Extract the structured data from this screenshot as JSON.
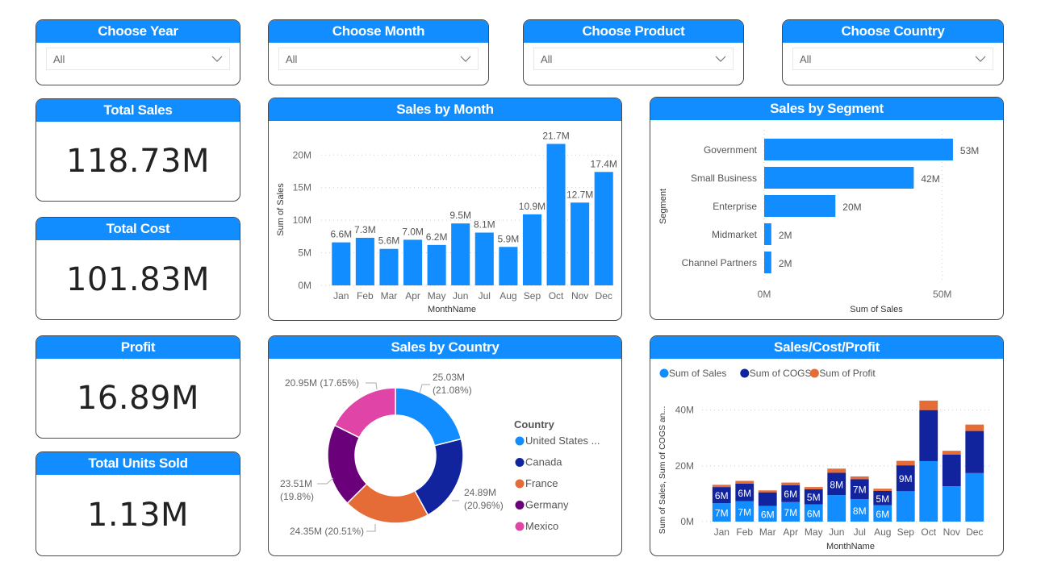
{
  "slicers": [
    {
      "title": "Choose Year",
      "value": "All"
    },
    {
      "title": "Choose Month",
      "value": "All"
    },
    {
      "title": "Choose Product",
      "value": "All"
    },
    {
      "title": "Choose Country",
      "value": "All"
    }
  ],
  "kpis": [
    {
      "title": "Total Sales",
      "value": "118.73M"
    },
    {
      "title": "Total Cost",
      "value": "101.83M"
    },
    {
      "title": "Profit",
      "value": "16.89M"
    },
    {
      "title": "Total Units Sold",
      "value": "1.13M"
    }
  ],
  "colors": {
    "accent": "#118DFF",
    "sales": "#118DFF",
    "cogs": "#12239E",
    "profit": "#E66C37",
    "germany": "#6B007B",
    "mexico": "#E044A7"
  },
  "chart_data": [
    {
      "id": "sales_by_month",
      "type": "bar",
      "title": "Sales by Month",
      "xlabel": "MonthName",
      "ylabel": "Sum of Sales",
      "categories": [
        "Jan",
        "Feb",
        "Mar",
        "Apr",
        "May",
        "Jun",
        "Jul",
        "Aug",
        "Sep",
        "Oct",
        "Nov",
        "Dec"
      ],
      "values": [
        6.6,
        7.3,
        5.6,
        7.0,
        6.2,
        9.5,
        8.1,
        5.9,
        10.9,
        21.7,
        12.7,
        17.4
      ],
      "data_labels": [
        "6.6M",
        "7.3M",
        "5.6M",
        "7.0M",
        "6.2M",
        "9.5M",
        "8.1M",
        "5.9M",
        "10.9M",
        "21.7M",
        "12.7M",
        "17.4M"
      ],
      "yticks": [
        0,
        5,
        10,
        15,
        20
      ],
      "ytick_labels": [
        "0M",
        "5M",
        "10M",
        "15M",
        "20M"
      ],
      "ylim": [
        0,
        23
      ],
      "unit": "M",
      "grid": true
    },
    {
      "id": "sales_by_segment",
      "type": "bar",
      "orientation": "horizontal",
      "title": "Sales by Segment",
      "xlabel": "Sum of Sales",
      "ylabel": "Segment",
      "categories": [
        "Government",
        "Small Business",
        "Enterprise",
        "Midmarket",
        "Channel Partners"
      ],
      "values": [
        53,
        42,
        20,
        2,
        2
      ],
      "data_labels": [
        "53M",
        "42M",
        "20M",
        "2M",
        "2M"
      ],
      "xticks": [
        0,
        50
      ],
      "xtick_labels": [
        "0M",
        "50M"
      ],
      "xlim": [
        0,
        58
      ],
      "grid": true
    },
    {
      "id": "sales_by_country",
      "type": "pie",
      "donut": true,
      "title": "Sales by Country",
      "legend_title": "Country",
      "legend_position": "right",
      "categories": [
        "United States ...",
        "Canada",
        "France",
        "Germany",
        "Mexico"
      ],
      "values": [
        25.03,
        24.89,
        24.35,
        23.51,
        20.95
      ],
      "percentages": [
        21.08,
        20.96,
        20.51,
        19.8,
        17.65
      ],
      "labels": [
        "25.03M (21.08%)",
        "24.89M (20.96%)",
        "24.35M (20.51%)",
        "23.51M (19.8%)",
        "20.95M (17.65%)"
      ],
      "colors": [
        "#118DFF",
        "#12239E",
        "#E66C37",
        "#6B007B",
        "#E044A7"
      ]
    },
    {
      "id": "sales_cost_profit",
      "type": "bar",
      "stacked": true,
      "title": "Sales/Cost/Profit",
      "xlabel": "MonthName",
      "ylabel": "Sum of Sales, Sum of COGS an...",
      "legend_position": "top-left",
      "categories": [
        "Jan",
        "Feb",
        "Mar",
        "Apr",
        "May",
        "Jun",
        "Jul",
        "Aug",
        "Sep",
        "Oct",
        "Nov",
        "Dec"
      ],
      "series": [
        {
          "name": "Sum of  Sales",
          "color": "#118DFF",
          "values": [
            6.6,
            7.3,
            5.6,
            7.0,
            6.2,
            9.5,
            8.1,
            5.9,
            10.9,
            21.7,
            12.7,
            17.4
          ],
          "labels": [
            "7M",
            "7M",
            "6M",
            "7M",
            "6M",
            "",
            "8M",
            "6M",
            "",
            "",
            "",
            ""
          ]
        },
        {
          "name": "Sum of COGS",
          "color": "#12239E",
          "values": [
            5.8,
            6.3,
            4.9,
            6.1,
            5.4,
            8.0,
            7.1,
            5.1,
            9.3,
            18.3,
            11.3,
            15.1
          ],
          "labels": [
            "6M",
            "6M",
            "",
            "6M",
            "5M",
            "8M",
            "7M",
            "5M",
            "9M",
            "",
            "",
            ""
          ]
        },
        {
          "name": "Sum of Profit",
          "color": "#E66C37",
          "values": [
            0.8,
            1.0,
            0.7,
            0.9,
            0.8,
            1.5,
            1.0,
            0.8,
            1.6,
            3.4,
            1.4,
            2.3
          ],
          "labels": [
            "",
            "",
            "",
            "",
            "",
            "",
            "",
            "",
            "",
            "",
            "",
            ""
          ]
        }
      ],
      "yticks": [
        0,
        20,
        40
      ],
      "ytick_labels": [
        "0M",
        "20M",
        "40M"
      ],
      "ylim": [
        0,
        48
      ],
      "grid": true
    }
  ]
}
